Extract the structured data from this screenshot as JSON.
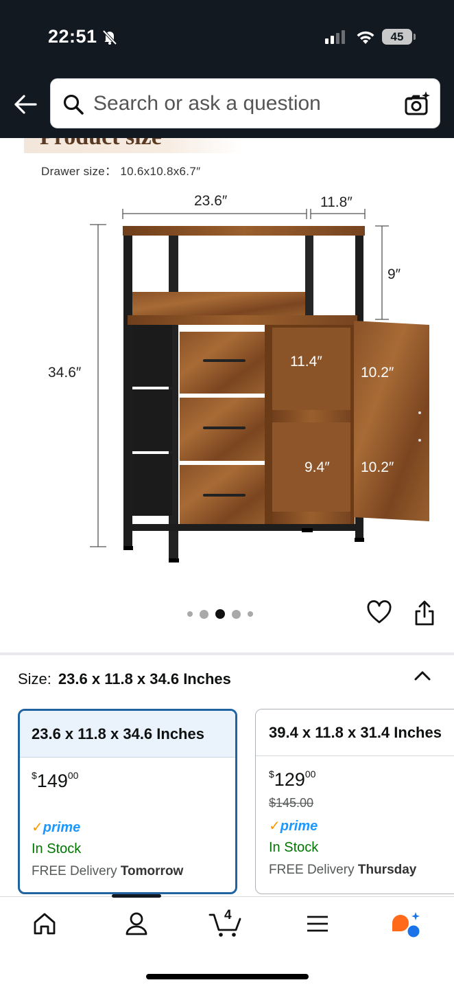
{
  "status_bar": {
    "time": "22:51",
    "battery": "45"
  },
  "search": {
    "placeholder": "Search or ask a question"
  },
  "product_image": {
    "banner_text": "Product size",
    "drawer_size": "Drawer size： 10.6x10.8x6.7″",
    "dimensions": {
      "width": "23.6″",
      "depth": "11.8″",
      "height": "34.6″",
      "top_shelf": "9″",
      "cabinet_width": "11.4″",
      "upper_height": "10.2″",
      "lower_depth": "9.4″",
      "lower_height": "10.2″"
    },
    "carousel": {
      "count": 5,
      "active_index": 2
    }
  },
  "size_selector": {
    "label": "Size:",
    "selected": "23.6 x 11.8 x 34.6 Inches"
  },
  "options": [
    {
      "title": "23.6 x 11.8 x 34.6 Inches",
      "price_symbol": "$",
      "price_whole": "149",
      "price_cents": "00",
      "prime": "prime",
      "stock": "In Stock",
      "delivery_prefix": "FREE Delivery",
      "delivery_day": "Tomorrow"
    },
    {
      "title": "39.4 x 11.8 x 31.4 Inches",
      "price_symbol": "$",
      "price_whole": "129",
      "price_cents": "00",
      "was_price": "$145.00",
      "prime": "prime",
      "stock": "In Stock",
      "delivery_prefix": "FREE Delivery",
      "delivery_day": "Thursday"
    }
  ],
  "bottom_nav": {
    "cart_count": "4",
    "items": [
      "home-icon",
      "account-icon",
      "cart-icon",
      "menu-icon",
      "rufus-icon"
    ]
  },
  "colors": {
    "header_bg": "#131921",
    "selected_border": "#2162a1",
    "prime_blue": "#1a98ff",
    "in_stock": "#007600"
  }
}
